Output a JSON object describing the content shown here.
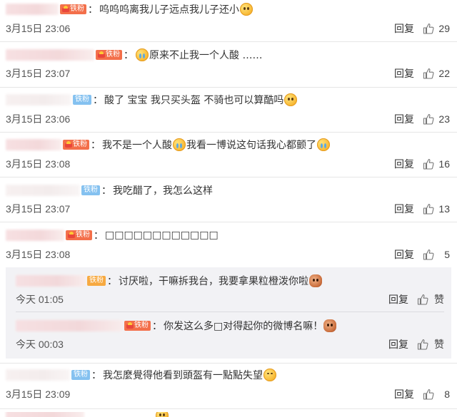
{
  "actions": {
    "reply": "回复",
    "like": "赞"
  },
  "comments": [
    {
      "badge": "铁粉",
      "text": "呜呜呜离我儿子远点我儿子还小",
      "time": "3月15日 23:06",
      "likes": "29"
    },
    {
      "badge": "铁粉",
      "text": "原来不止我一个人酸 ……",
      "time": "3月15日 23:07",
      "likes": "22"
    },
    {
      "badge": "铁粉",
      "text_a": "酸了 宝宝 我只买头盔 不骑也可以算酷吗",
      "time": "3月15日 23:06",
      "likes": "23"
    },
    {
      "badge": "铁粉",
      "text_a": "我不是一个人酸",
      "text_b": "我看一博说这句话我心都颤了",
      "time": "3月15日 23:08",
      "likes": "16"
    },
    {
      "badge": "铁粉",
      "text": "我吃醋了，我怎么这样",
      "time": "3月15日 23:07",
      "likes": "13"
    },
    {
      "badge": "铁粉",
      "text": "□□□□□□□□□□□□",
      "time": "3月15日 23:08",
      "likes": "5"
    },
    {
      "badge": "铁粉",
      "text": "我怎麼覺得他看到頭盔有一點點失望",
      "time": "3月15日 23:09",
      "likes": "8"
    }
  ],
  "replies": [
    {
      "badge": "铁粉",
      "text": "讨厌啦，干嘛拆我台，我要拿果粒橙泼你啦",
      "time": "今天 01:05"
    },
    {
      "badge": "铁粉",
      "text": "你发这么多□对得起你的微博名嘛！",
      "time": "今天 00:03"
    }
  ],
  "icons": {
    "thumb": "thumbs-up-icon",
    "crown": "crown-icon",
    "emoji": "emoji-icon"
  },
  "colors": {
    "fan_badge": "#f7a940",
    "blue_badge": "#84c1f0",
    "reply_bg": "#f2f2f5"
  }
}
